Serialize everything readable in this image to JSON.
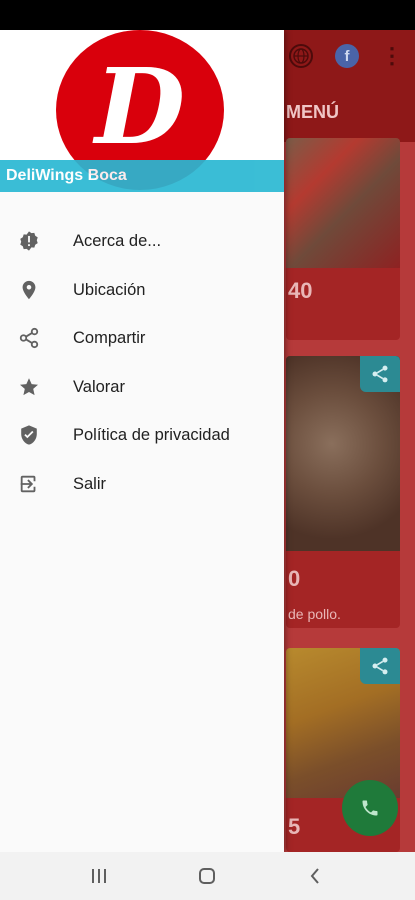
{
  "drawer": {
    "brand_name": "DeliWings Boca",
    "logo_letter": "D",
    "items": [
      {
        "label": "Acerca de...",
        "icon": "info-badge-icon"
      },
      {
        "label": "Ubicación",
        "icon": "location-pin-icon"
      },
      {
        "label": "Compartir",
        "icon": "share-icon"
      },
      {
        "label": "Valorar",
        "icon": "star-icon"
      },
      {
        "label": "Política de privacidad",
        "icon": "shield-icon"
      },
      {
        "label": "Salir",
        "icon": "exit-icon"
      }
    ]
  },
  "background": {
    "title": "MENÚ",
    "cards": [
      {
        "price": "40"
      },
      {
        "price": "0",
        "desc": "de pollo."
      },
      {
        "price": "5"
      }
    ]
  },
  "colors": {
    "accent": "#2ab8d3",
    "logo_red": "#d9000c",
    "app_red": "#b63a3a",
    "fab_green": "#1f7a3a"
  }
}
